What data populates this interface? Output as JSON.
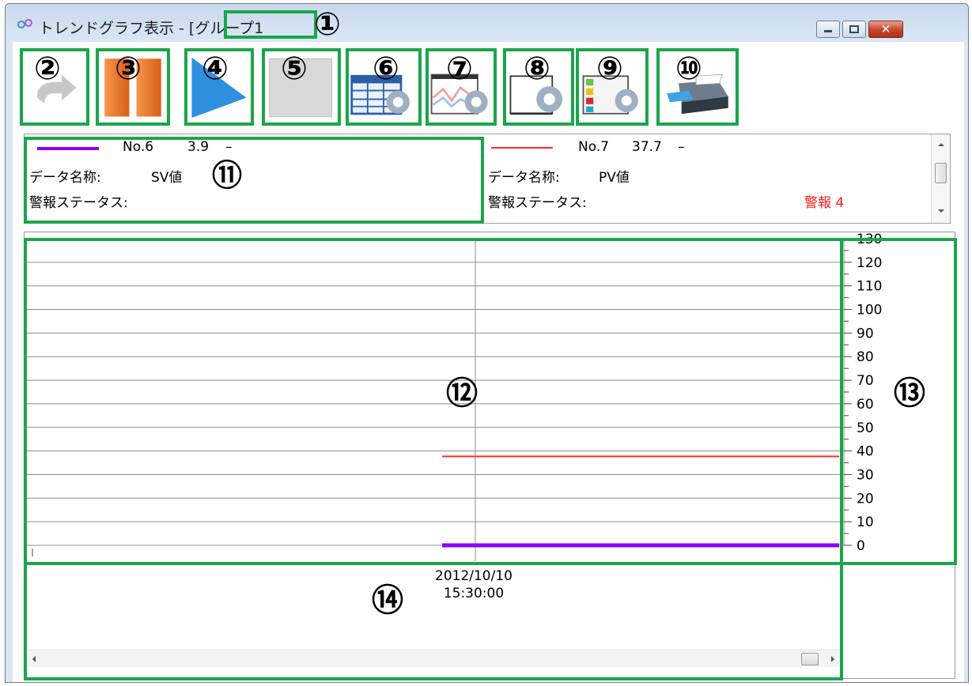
{
  "window": {
    "title": "トレンドグラフ表示 - [グループ1"
  },
  "toolbar": {
    "buttons": [
      {
        "number": "②",
        "icon": "refresh-icon"
      },
      {
        "number": "③",
        "icon": "pause-icon"
      },
      {
        "number": "④",
        "icon": "play-icon"
      },
      {
        "number": "⑤",
        "icon": "stop-icon"
      },
      {
        "number": "⑥",
        "icon": "table-settings-icon"
      },
      {
        "number": "⑦",
        "icon": "graph-settings-icon"
      },
      {
        "number": "⑧",
        "icon": "axis-settings-icon"
      },
      {
        "number": "⑨",
        "icon": "legend-settings-icon"
      },
      {
        "number": "⑩",
        "icon": "printer-icon"
      }
    ]
  },
  "callouts": {
    "title_box": "①",
    "legend_box": "⑪",
    "graph_box": "⑫",
    "scale_box": "⑬",
    "time_box": "⑭"
  },
  "legend": {
    "items": [
      {
        "no": "No.6",
        "value": "3.9",
        "unit": "–",
        "name_label": "データ名称:",
        "name": "SV値",
        "alarm_label": "警報ステータス:",
        "alarm": "",
        "color": "#8a00ff"
      },
      {
        "no": "No.7",
        "value": "37.7",
        "unit": "–",
        "name_label": "データ名称:",
        "name": "PV値",
        "alarm_label": "警報ステータス:",
        "alarm": "警報 4",
        "color": "#ff2a2a"
      }
    ]
  },
  "chart_data": {
    "type": "line",
    "y_ticks": [
      "130",
      "120",
      "110",
      "100",
      "90",
      "80",
      "70",
      "60",
      "50",
      "40",
      "30",
      "20",
      "10",
      "0"
    ],
    "ylim": [
      0,
      130
    ],
    "x_tick_labels": [
      "2012/10/10",
      "15:30:00"
    ],
    "series": [
      {
        "name": "No.7",
        "color": "#ff2a2a",
        "value": 37.7
      },
      {
        "name": "No.6",
        "color": "#8a00ff",
        "value": 0
      }
    ]
  }
}
